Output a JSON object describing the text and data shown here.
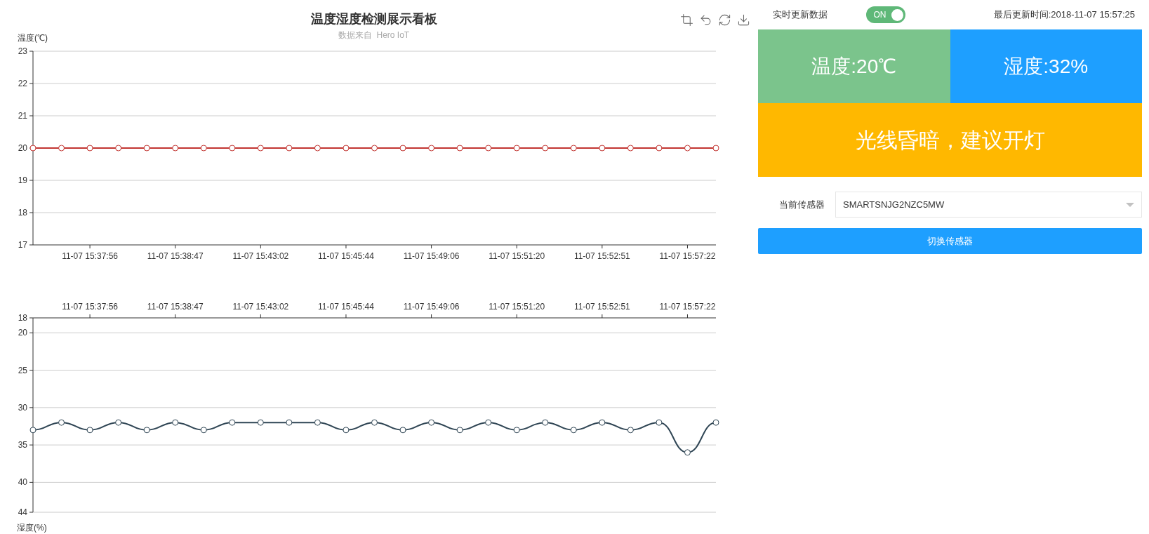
{
  "title": "温度湿度检测展示看板",
  "subtitle": "数据来自  Hero IoT",
  "temperature_chart": {
    "chart_data": {
      "type": "line",
      "grid": true,
      "categories": [
        null,
        null,
        "11-07 15:37:56",
        null,
        null,
        "11-07 15:38:47",
        null,
        null,
        "11-07 15:43:02",
        null,
        null,
        "11-07 15:45:44",
        null,
        null,
        "11-07 15:49:06",
        null,
        null,
        "11-07 15:51:20",
        null,
        null,
        "11-07 15:52:51",
        null,
        null,
        "11-07 15:57:22",
        null
      ],
      "ylabel": "温度(℃)",
      "ylim": [
        17,
        23
      ],
      "yticks": [
        17,
        18,
        19,
        20,
        21,
        22,
        23
      ],
      "series": [
        {
          "color": "#c23531",
          "marker": "circle",
          "values": [
            20,
            20,
            20,
            20,
            20,
            20,
            20,
            20,
            20,
            20,
            20,
            20,
            20,
            20,
            20,
            20,
            20,
            20,
            20,
            20,
            20,
            20,
            20,
            20,
            20
          ]
        }
      ]
    }
  },
  "humidity_chart": {
    "smooth": true,
    "chart_data": {
      "type": "line",
      "grid": true,
      "categories": [
        null,
        null,
        "11-07 15:37:56",
        null,
        null,
        "11-07 15:38:47",
        null,
        null,
        "11-07 15:43:02",
        null,
        null,
        "11-07 15:45:44",
        null,
        null,
        "11-07 15:49:06",
        null,
        null,
        "11-07 15:51:20",
        null,
        null,
        "11-07 15:52:51",
        null,
        null,
        "11-07 15:57:22",
        null
      ],
      "ylabel": "湿度(%)",
      "ylim": [
        44,
        18
      ],
      "yticks": [
        18,
        20,
        25,
        30,
        35,
        40,
        44
      ],
      "series": [
        {
          "color": "#2f4554",
          "marker": "circle",
          "values": [
            33,
            32,
            33,
            32,
            33,
            32,
            33,
            32,
            32,
            32,
            32,
            33,
            32,
            33,
            32,
            33,
            32,
            33,
            32,
            33,
            32,
            33,
            32,
            36,
            32
          ]
        }
      ]
    }
  },
  "realtime": {
    "label": "实时更新数据",
    "on": true,
    "switch_text": "ON"
  },
  "last_update": "最后更新时间:2018-11-07 15:57:25",
  "tiles": [
    {
      "text": "温度:20℃",
      "color": "#7bc48c"
    },
    {
      "text": "湿度:32%",
      "color": "#1e9fff"
    }
  ],
  "notice": {
    "text": "光线昏暗，建议开灯",
    "color": "#ffb800"
  },
  "sensor": {
    "label": "当前传感器",
    "value": "SMARTSNJG2NZC5MW"
  },
  "switch_button": "切换传感器"
}
